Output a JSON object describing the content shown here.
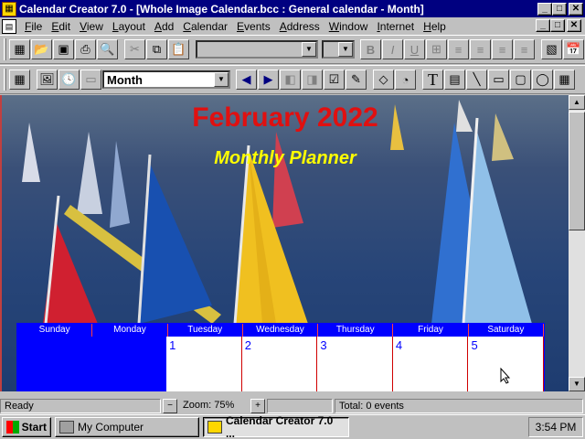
{
  "window": {
    "title": "Calendar Creator 7.0 - [Whole Image Calendar.bcc : General calendar - Month]",
    "controls": {
      "minimize": "_",
      "maximize": "□",
      "close": "✕"
    }
  },
  "menu": [
    "File",
    "Edit",
    "View",
    "Layout",
    "Add",
    "Calendar",
    "Events",
    "Address",
    "Window",
    "Internet",
    "Help"
  ],
  "toolbar": {
    "view_select": "Month",
    "font_select": "",
    "size_select": "",
    "format_buttons": [
      "B",
      "I",
      "U"
    ]
  },
  "calendar": {
    "title": "February 2022",
    "subtitle": "Monthly Planner",
    "weekdays": [
      "Sunday",
      "Monday",
      "Tuesday",
      "Wednesday",
      "Thursday",
      "Friday",
      "Saturday"
    ],
    "first_week": [
      "",
      "",
      "1",
      "2",
      "3",
      "4",
      "5"
    ],
    "title_color": "#e01010",
    "subtitle_color": "#ffff00",
    "grid_color": "#0000ff"
  },
  "status": {
    "text": "Ready",
    "zoom": "Zoom: 75%",
    "events": "Total: 0 events"
  },
  "taskbar": {
    "start": "Start",
    "items": [
      "My Computer",
      "Calendar Creator 7.0 ..."
    ],
    "clock": "3:54 PM"
  }
}
